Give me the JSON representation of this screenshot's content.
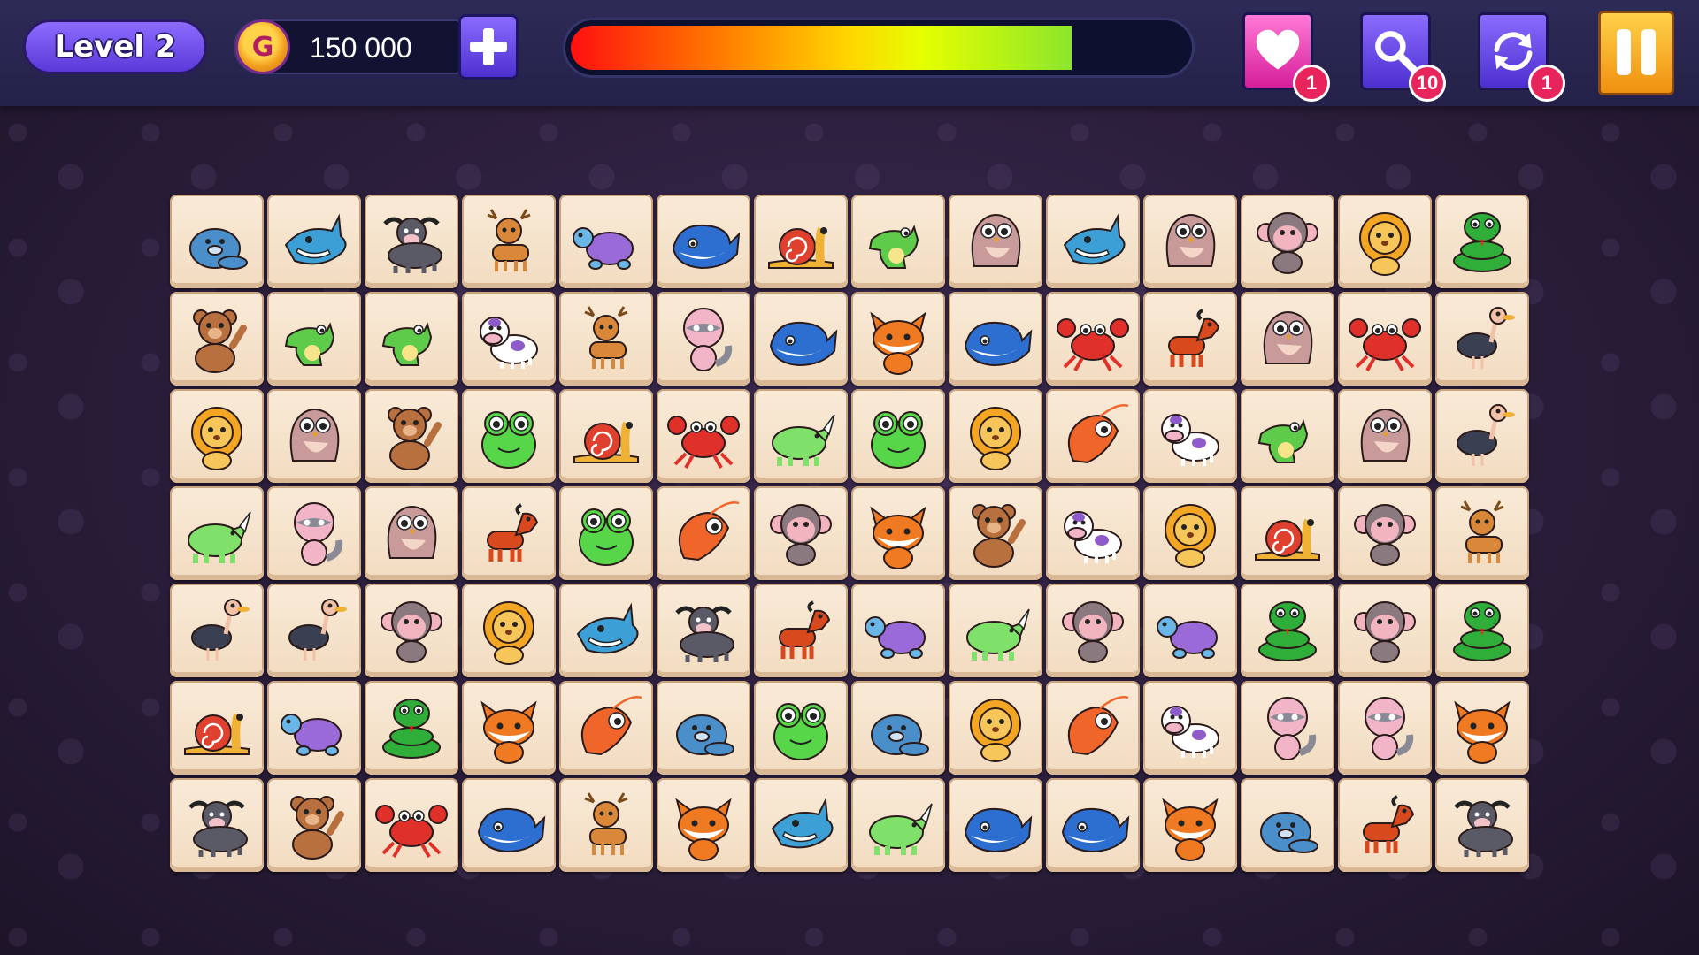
{
  "hud": {
    "level_label": "Level 2",
    "coin_symbol": "G",
    "coins": "150 000",
    "timer_fraction": 0.82,
    "powerups": {
      "hearts": "1",
      "hints": "10",
      "shuffles": "1"
    }
  },
  "colors": {
    "seal": "#4a8fc9",
    "shark": "#3c9fd6",
    "buffalo": "#5a5a66",
    "deer": "#d9883a",
    "turtle": "#9a6ad8",
    "whale": "#2d6fd0",
    "snail": "#f0b236",
    "croc": "#5ecb4a",
    "owl": "#c99a9a",
    "monkey": "#8a7a80",
    "lion": "#f3a623",
    "snake": "#2fae3a",
    "bear": "#b8703e",
    "cow": "#8f5ac9",
    "raccoon": "#8a8a96",
    "fox": "#f07a22",
    "crab": "#e0302a",
    "horse": "#d84a1e",
    "ostrich": "#3a3f52",
    "frog": "#57d64a",
    "rhino": "#7fe06a",
    "shrimp": "#f0662a"
  },
  "board": {
    "rows": [
      [
        "seal",
        "shark",
        "buffalo",
        "deer",
        "turtle",
        "whale",
        "snail",
        "croc",
        "owl",
        "shark",
        "owl",
        "monkey",
        "lion",
        "snake"
      ],
      [
        "bear",
        "croc",
        "croc",
        "cow",
        "deer",
        "raccoon",
        "whale",
        "fox",
        "whale",
        "crab",
        "horse",
        "owl",
        "crab",
        "ostrich"
      ],
      [
        "lion",
        "owl",
        "bear",
        "frog",
        "snail",
        "crab",
        "rhino",
        "frog",
        "lion",
        "shrimp",
        "cow",
        "croc",
        "owl",
        "ostrich"
      ],
      [
        "rhino",
        "raccoon",
        "owl",
        "horse",
        "frog",
        "shrimp",
        "monkey",
        "fox",
        "bear",
        "cow",
        "lion",
        "snail",
        "monkey",
        "deer"
      ],
      [
        "ostrich",
        "ostrich",
        "monkey",
        "lion",
        "shark",
        "buffalo",
        "horse",
        "turtle",
        "rhino",
        "monkey",
        "turtle",
        "snake",
        "monkey",
        "snake"
      ],
      [
        "snail",
        "turtle",
        "snake",
        "fox",
        "shrimp",
        "seal",
        "frog",
        "seal",
        "lion",
        "shrimp",
        "cow",
        "raccoon",
        "raccoon",
        "fox"
      ],
      [
        "buffalo",
        "bear",
        "crab",
        "whale",
        "deer",
        "fox",
        "shark",
        "rhino",
        "whale",
        "whale",
        "fox",
        "seal",
        "horse",
        "buffalo"
      ]
    ]
  }
}
